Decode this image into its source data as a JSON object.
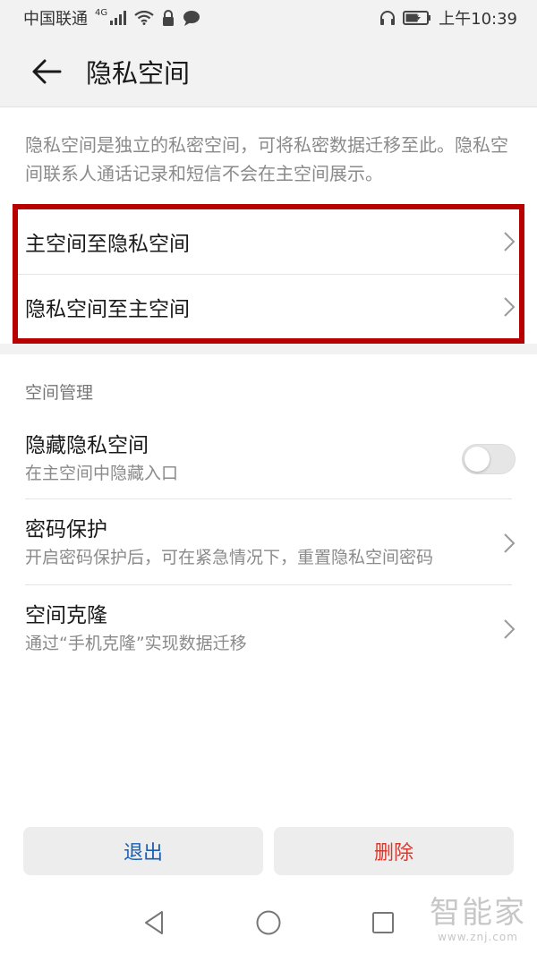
{
  "status_bar": {
    "carrier": "中国联通",
    "network": "4G",
    "time": "上午10:39"
  },
  "header": {
    "title": "隐私空间"
  },
  "intro": {
    "text": "隐私空间是独立的私密空间，可将私密数据迁移至此。隐私空间联系人通话记录和短信不会在主空间展示。"
  },
  "migrate": {
    "items": [
      {
        "label": "主空间至隐私空间"
      },
      {
        "label": "隐私空间至主空间"
      }
    ],
    "highlight_color": "#b80000"
  },
  "section": {
    "title": "空间管理"
  },
  "settings": {
    "hide": {
      "title": "隐藏隐私空间",
      "sub": "在主空间中隐藏入口",
      "toggle_on": false
    },
    "password": {
      "title": "密码保护",
      "sub": "开启密码保护后，可在紧急情况下，重置隐私空间密码"
    },
    "clone": {
      "title": "空间克隆",
      "sub": "通过“手机克隆”实现数据迁移"
    }
  },
  "buttons": {
    "exit": {
      "label": "退出",
      "color": "#1a5fb4"
    },
    "delete": {
      "label": "删除",
      "color": "#d63a2f"
    }
  },
  "watermark": {
    "brand": "智能家",
    "url": "www.znj.com"
  }
}
